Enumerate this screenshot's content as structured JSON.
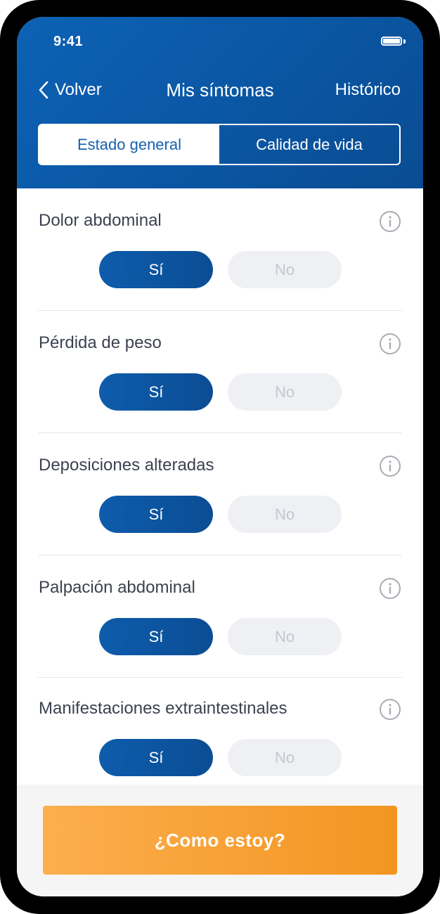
{
  "status_bar": {
    "time": "9:41",
    "battery_icon": "battery-icon"
  },
  "nav": {
    "back_label": "Volver",
    "back_icon": "chevron-left-icon",
    "title": "Mis síntomas",
    "right_label": "Histórico"
  },
  "tabs": [
    {
      "label": "Estado general",
      "selected": true
    },
    {
      "label": "Calidad de vida",
      "selected": false
    }
  ],
  "symptoms": [
    {
      "label": "Dolor abdominal",
      "yes_label": "Sí",
      "no_label": "No",
      "selected": "yes"
    },
    {
      "label": "Pérdida de peso",
      "yes_label": "Sí",
      "no_label": "No",
      "selected": "yes"
    },
    {
      "label": "Deposiciones alteradas",
      "yes_label": "Sí",
      "no_label": "No",
      "selected": "yes"
    },
    {
      "label": "Palpación abdominal",
      "yes_label": "Sí",
      "no_label": "No",
      "selected": "yes"
    },
    {
      "label": "Manifestaciones extraintestinales",
      "yes_label": "Sí",
      "no_label": "No",
      "selected": "yes"
    }
  ],
  "cta": {
    "label": "¿Como estoy?"
  },
  "colors": {
    "header_blue": "#0d62b5",
    "selected_button": "#0b4d94",
    "unselected_button": "#eef0f4",
    "cta_orange": "#f39520"
  }
}
